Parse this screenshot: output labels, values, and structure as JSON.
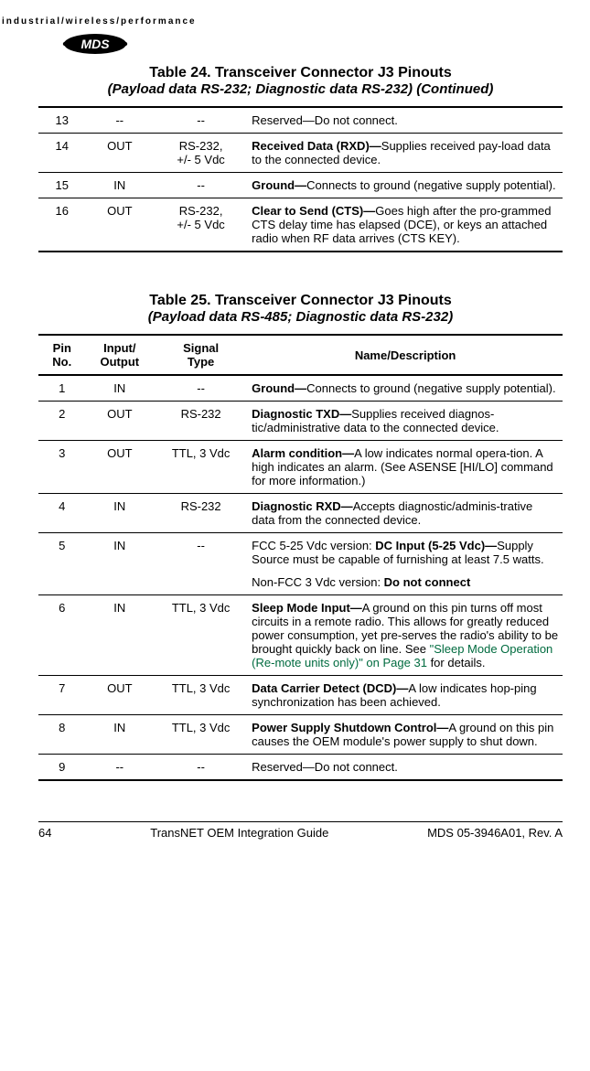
{
  "header_strip": "industrial/wireless/performance",
  "table24": {
    "title": "Table 24. Transceiver Connector J3 Pinouts",
    "subtitle": "(Payload data RS-232; Diagnostic data RS-232)  (Continued)",
    "rows": [
      {
        "pin": "13",
        "io": "--",
        "sig": "--",
        "desc_bold": "",
        "desc_plain": "Reserved—Do not connect."
      },
      {
        "pin": "14",
        "io": "OUT",
        "sig": "RS-232,\n+/- 5 Vdc",
        "desc_bold": "Received Data (RXD)—",
        "desc_plain": "Supplies received pay-load data to the connected device."
      },
      {
        "pin": "15",
        "io": "IN",
        "sig": "--",
        "desc_bold": "Ground—",
        "desc_plain": "Connects to ground (negative supply potential)."
      },
      {
        "pin": "16",
        "io": "OUT",
        "sig": "RS-232,\n+/- 5 Vdc",
        "desc_bold": "Clear to Send (CTS)—",
        "desc_plain": "Goes high after the pro-grammed CTS delay time has elapsed (DCE), or keys an attached radio when RF data arrives (CTS KEY)."
      }
    ]
  },
  "table25": {
    "title": "Table 25. Transceiver Connector J3 Pinouts",
    "subtitle": "(Payload data RS-485; Diagnostic data RS-232)",
    "headers": {
      "pin": "Pin No.",
      "io": "Input/\nOutput",
      "sig": "Signal\nType",
      "desc": "Name/Description"
    },
    "rows": {
      "r1": {
        "pin": "1",
        "io": "IN",
        "sig": "--",
        "desc_bold": "Ground—",
        "desc_plain": "Connects to ground (negative supply potential)."
      },
      "r2": {
        "pin": "2",
        "io": "OUT",
        "sig": "RS-232",
        "desc_bold": "Diagnostic TXD—",
        "desc_plain": "Supplies received diagnos-tic/administrative data to the connected device."
      },
      "r3": {
        "pin": "3",
        "io": "OUT",
        "sig": "TTL, 3 Vdc",
        "desc_bold": "Alarm condition—",
        "desc_plain": "A low indicates normal opera-tion. A high indicates an alarm. (See ASENSE [HI/LO] command for more information.)"
      },
      "r4": {
        "pin": "4",
        "io": "IN",
        "sig": "RS-232",
        "desc_bold": "Diagnostic RXD—",
        "desc_plain": "Accepts diagnostic/adminis-trative data from the connected device."
      },
      "r5": {
        "pin": "5",
        "io": "IN",
        "sig": "--",
        "p1_pre": "FCC 5-25 Vdc version: ",
        "p1_bold": "DC Input (5-25 Vdc)—",
        "p1_post": "Supply Source must be capable of furnishing at least 7.5 watts.",
        "p2_pre": "Non-FCC 3 Vdc version: ",
        "p2_bold": "Do not connect"
      },
      "r6": {
        "pin": "6",
        "io": "IN",
        "sig": "TTL, 3 Vdc",
        "desc_bold": "Sleep Mode Input—",
        "desc_plain_a": "A ground on this pin turns off most circuits in a remote radio. This allows for greatly reduced power consumption, yet pre-serves the radio's ability to be brought quickly back on line. See ",
        "desc_link": "\"Sleep Mode Operation (Re-mote units only)\" on Page 31",
        "desc_plain_b": " for details."
      },
      "r7": {
        "pin": "7",
        "io": "OUT",
        "sig": "TTL, 3 Vdc",
        "desc_bold": "Data Carrier Detect (DCD)—",
        "desc_plain": "A low indicates hop-ping synchronization has been achieved."
      },
      "r8": {
        "pin": "8",
        "io": "IN",
        "sig": "TTL, 3 Vdc",
        "desc_bold": "Power Supply Shutdown Control—",
        "desc_plain": "A ground on this pin causes the OEM module's power supply to shut down."
      },
      "r9": {
        "pin": "9",
        "io": "--",
        "sig": "--",
        "desc_bold": "",
        "desc_plain": "Reserved—Do not connect."
      }
    }
  },
  "footer": {
    "page": "64",
    "guide": "TransNET OEM Integration Guide",
    "doc": "MDS 05-3946A01, Rev.  A"
  }
}
